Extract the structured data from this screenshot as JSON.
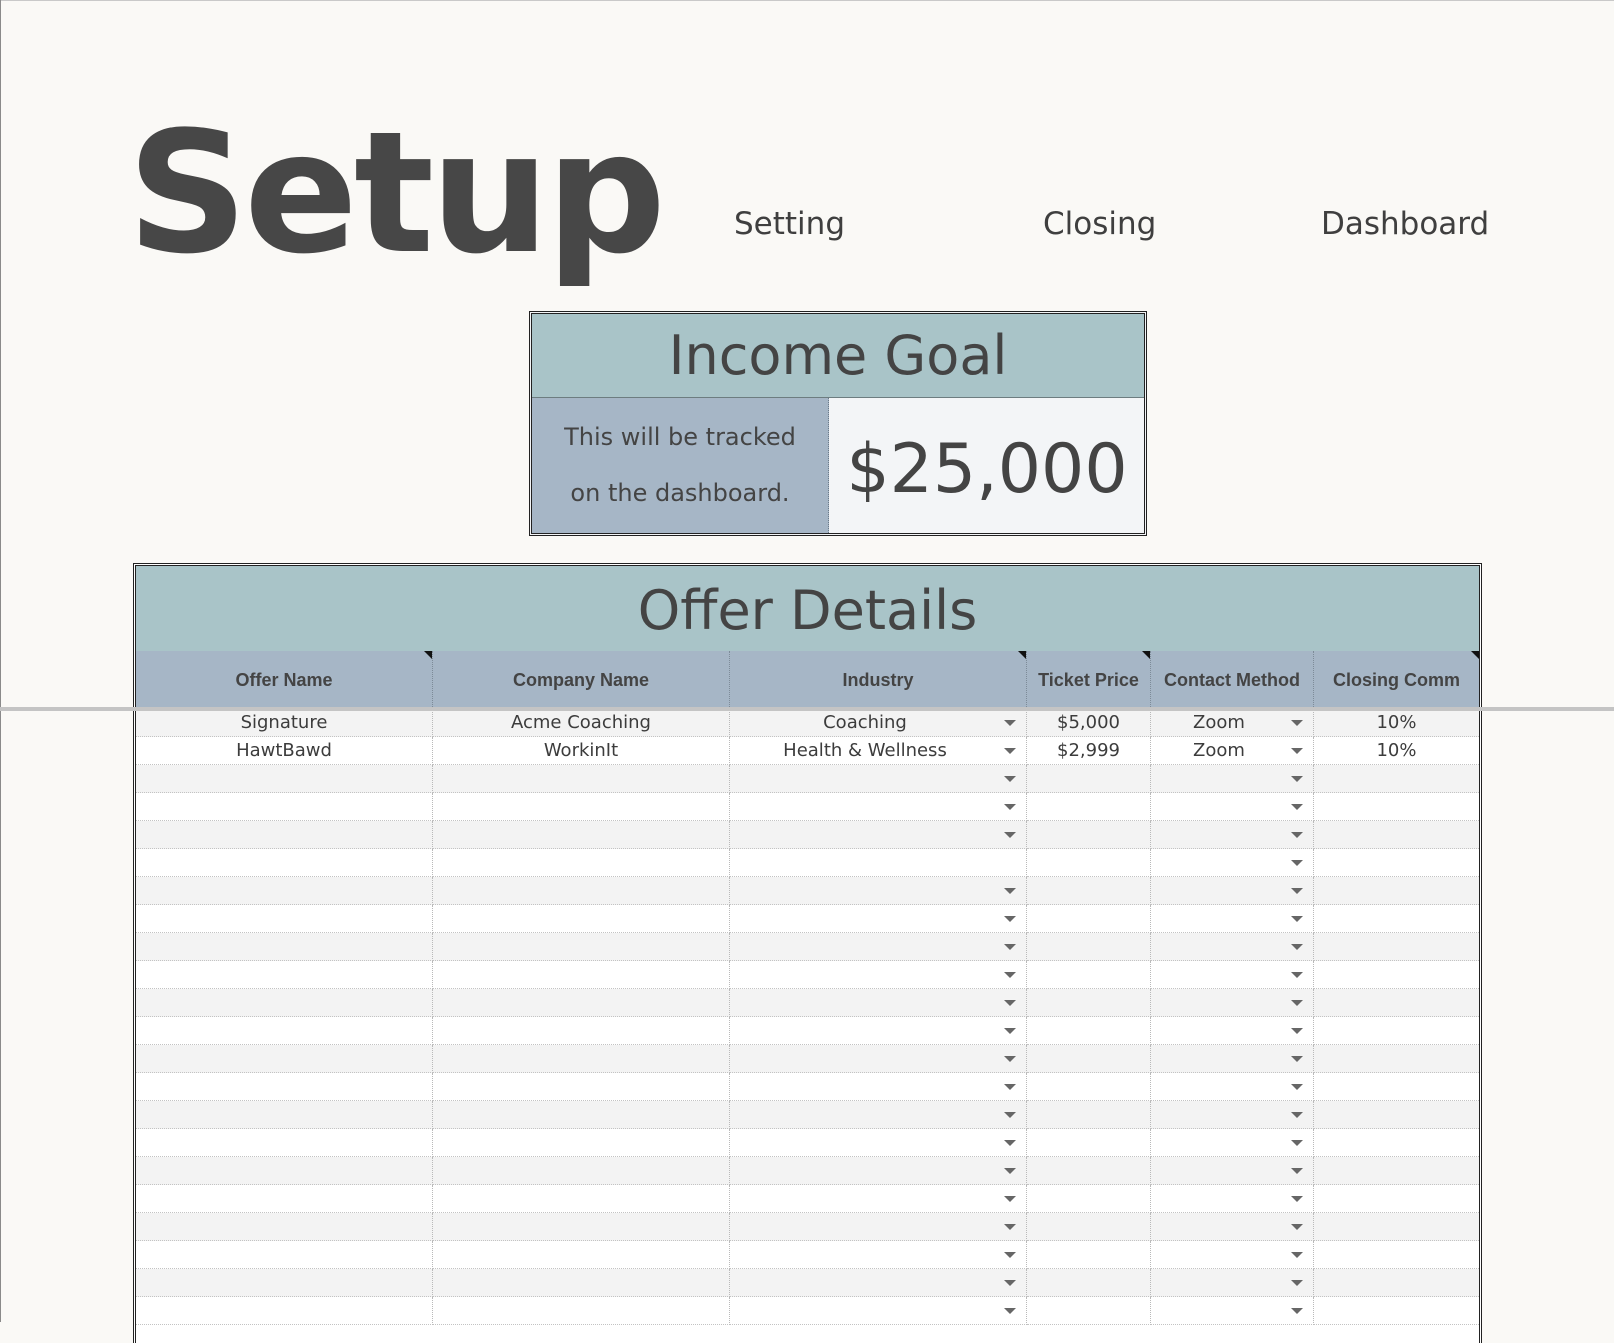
{
  "page": {
    "title": "Setup"
  },
  "nav": {
    "setting": "Setting",
    "closing": "Closing",
    "dashboard": "Dashboard"
  },
  "income_goal": {
    "title": "Income Goal",
    "note_line1": "This will be tracked",
    "note_line2": "on the dashboard.",
    "value": "$25,000"
  },
  "offer_details": {
    "title": "Offer Details",
    "columns": [
      "Offer Name",
      "Company Name",
      "Industry",
      "Ticket Price",
      "Contact Method",
      "Closing Comm"
    ],
    "rows": [
      [
        "Signature",
        "Acme Coaching",
        "Coaching",
        "$5,000",
        "Zoom",
        "10%"
      ],
      [
        "HawtBawd",
        "WorkinIt",
        "Health & Wellness",
        "$2,999",
        "Zoom",
        "10%"
      ],
      [
        "",
        "",
        "",
        "",
        "",
        ""
      ],
      [
        "",
        "",
        "",
        "",
        "",
        ""
      ],
      [
        "",
        "",
        "",
        "",
        "",
        ""
      ],
      [
        "",
        "",
        "",
        "",
        "",
        ""
      ],
      [
        "",
        "",
        "",
        "",
        "",
        ""
      ],
      [
        "",
        "",
        "",
        "",
        "",
        ""
      ],
      [
        "",
        "",
        "",
        "",
        "",
        ""
      ],
      [
        "",
        "",
        "",
        "",
        "",
        ""
      ],
      [
        "",
        "",
        "",
        "",
        "",
        ""
      ],
      [
        "",
        "",
        "",
        "",
        "",
        ""
      ],
      [
        "",
        "",
        "",
        "",
        "",
        ""
      ],
      [
        "",
        "",
        "",
        "",
        "",
        ""
      ],
      [
        "",
        "",
        "",
        "",
        "",
        ""
      ],
      [
        "",
        "",
        "",
        "",
        "",
        ""
      ],
      [
        "",
        "",
        "",
        "",
        "",
        ""
      ],
      [
        "",
        "",
        "",
        "",
        "",
        ""
      ],
      [
        "",
        "",
        "",
        "",
        "",
        ""
      ],
      [
        "",
        "",
        "",
        "",
        "",
        ""
      ],
      [
        "",
        "",
        "",
        "",
        "",
        ""
      ],
      [
        "",
        "",
        "",
        "",
        "",
        ""
      ]
    ]
  }
}
